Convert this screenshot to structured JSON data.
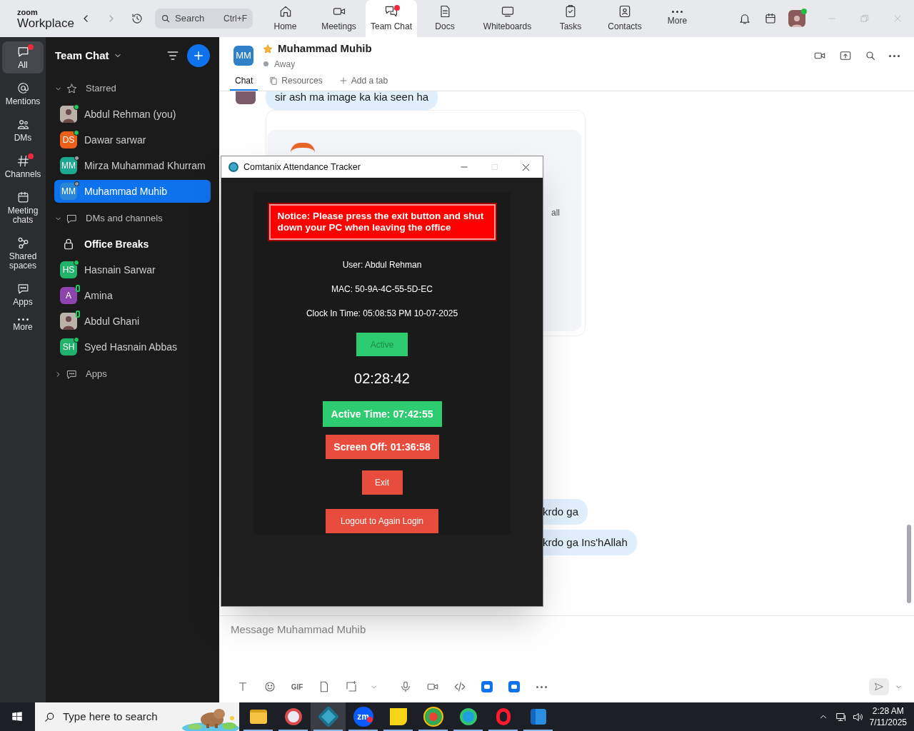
{
  "top_bar": {
    "brand": {
      "small": "zoom",
      "large": "Workplace"
    },
    "search": {
      "placeholder": "Search",
      "shortcut": "Ctrl+F"
    },
    "nav": [
      {
        "label": "Home",
        "selected": false,
        "badge": false
      },
      {
        "label": "Meetings",
        "selected": false,
        "badge": false
      },
      {
        "label": "Team Chat",
        "selected": true,
        "badge": true
      },
      {
        "label": "Docs",
        "selected": false,
        "badge": false
      },
      {
        "label": "Whiteboards",
        "selected": false,
        "badge": false
      },
      {
        "label": "Tasks",
        "selected": false,
        "badge": false
      },
      {
        "label": "Contacts",
        "selected": false,
        "badge": false
      },
      {
        "label": "More",
        "selected": false,
        "badge": false
      }
    ],
    "profile": {
      "presence": {
        "kind": "online"
      }
    }
  },
  "rail": [
    {
      "label": "All",
      "selected": true,
      "badge": true
    },
    {
      "label": "Mentions",
      "selected": false,
      "badge": false
    },
    {
      "label": "DMs",
      "selected": false,
      "badge": false
    },
    {
      "label": "Channels",
      "selected": false,
      "badge": true
    },
    {
      "label": "Meeting chats",
      "selected": false,
      "badge": false
    },
    {
      "label": "Shared spaces",
      "selected": false,
      "badge": false
    },
    {
      "label": "Apps",
      "selected": false,
      "badge": false
    },
    {
      "label": "More",
      "selected": false,
      "badge": false
    }
  ],
  "sidebar": {
    "title": "Team Chat",
    "sections": [
      {
        "label": "Starred",
        "expanded": true,
        "items": [
          {
            "kind": "person",
            "name": "Abdul Rehman (you)",
            "presence": {
              "kind": "online"
            },
            "selected": false,
            "unread": false
          },
          {
            "kind": "person",
            "name": "Dawar sarwar",
            "avatar": {
              "kind": "initials",
              "text": "DS",
              "color": "#e8601c"
            },
            "presence": {
              "kind": "online"
            },
            "selected": false,
            "unread": false
          },
          {
            "kind": "person",
            "name": "Mirza Muhammad Khurram",
            "avatar": {
              "kind": "initials",
              "text": "MM",
              "color": "#1ea88f"
            },
            "presence": {
              "kind": "away"
            },
            "selected": false,
            "unread": false
          },
          {
            "kind": "person",
            "name": "Muhammad Muhib",
            "avatar": {
              "kind": "initials",
              "text": "MM",
              "color": "#2a86d6"
            },
            "presence": {
              "kind": "away"
            },
            "selected": true,
            "unread": false
          }
        ]
      },
      {
        "label": "DMs and channels",
        "expanded": true,
        "items": [
          {
            "kind": "channel",
            "name": "Office Breaks",
            "selected": false,
            "unread": true
          },
          {
            "kind": "person",
            "name": "Hasnain Sarwar",
            "avatar": {
              "kind": "initials",
              "text": "HS",
              "color": "#21b36b"
            },
            "presence": {
              "kind": "online"
            },
            "selected": false,
            "unread": false
          },
          {
            "kind": "person",
            "name": "Amina",
            "avatar": {
              "kind": "initials",
              "text": "A",
              "color": "#8e44ad"
            },
            "presence": {
              "kind": "mobile"
            },
            "selected": false,
            "unread": false
          },
          {
            "kind": "person",
            "name": "Abdul Ghani",
            "presence": {
              "kind": "mobile"
            },
            "selected": false,
            "unread": false
          },
          {
            "kind": "person",
            "name": "Syed Hasnain Abbas",
            "avatar": {
              "kind": "initials",
              "text": "SH",
              "color": "#21b36b"
            },
            "presence": {
              "kind": "online"
            },
            "selected": false,
            "unread": false
          }
        ]
      },
      {
        "label": "Apps",
        "expanded": false
      }
    ]
  },
  "chat": {
    "contact": {
      "avatar": {
        "text": "MM",
        "color": "#2f80c8"
      },
      "starred": true,
      "name": "Muhammad Muhib",
      "status": "Away"
    },
    "tabs": [
      {
        "label": "Chat",
        "selected": true
      },
      {
        "label": "Resources",
        "selected": false
      },
      {
        "label": "Add a tab",
        "selected": false
      }
    ],
    "messages": [
      {
        "kind": "bubble",
        "text": "sir ash ma image ka kia seen ha",
        "avatar": true
      },
      {
        "kind": "quote_card",
        "text": "all"
      },
      {
        "kind": "bubble",
        "text": "krdo ga",
        "avatar": false
      },
      {
        "kind": "bubble",
        "text": "krdo ga Ins'hAllah",
        "avatar": false
      }
    ],
    "composer": {
      "placeholder": "Message Muhammad Muhib",
      "gif": "GIF"
    }
  },
  "tracker": {
    "title": "Comtanix Attendance Tracker",
    "notice": "Notice: Please press the exit button and shut down your PC when leaving the office",
    "info": [
      "User: Abdul Rehman",
      "MAC: 50-9A-4C-55-5D-EC",
      "Clock In Time: 05:08:53 PM 10-07-2025"
    ],
    "status": {
      "label": "Active",
      "kind": "active"
    },
    "timer": "02:28:42",
    "counters": [
      {
        "label": "Active Time: 07:42:55",
        "kind": "active"
      },
      {
        "label": "Screen Off: 01:36:58",
        "kind": "off"
      }
    ],
    "buttons": [
      "Exit",
      "Logout to Again Login"
    ]
  },
  "taskbar": {
    "search_placeholder": "Type here to search",
    "apps": [
      {
        "selected": false,
        "badge": false
      },
      {
        "selected": false,
        "badge": false
      },
      {
        "selected": true,
        "badge": false
      },
      {
        "label": "zm",
        "selected": false,
        "badge": true
      },
      {
        "selected": false,
        "badge": false
      },
      {
        "selected": false,
        "badge": false
      },
      {
        "selected": false,
        "badge": false
      },
      {
        "selected": false,
        "badge": false
      },
      {
        "selected": false,
        "badge": false
      }
    ],
    "clock": {
      "time": "2:28 AM",
      "date": "7/11/2025"
    }
  }
}
